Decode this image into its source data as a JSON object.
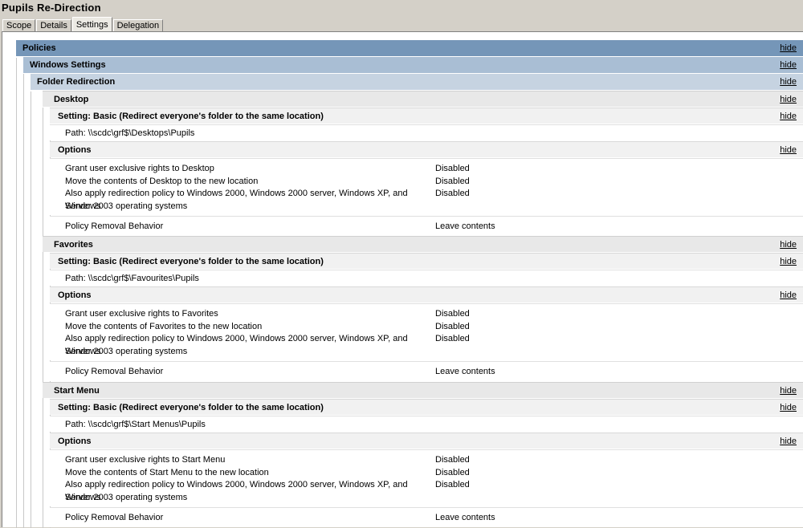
{
  "window": {
    "title": "Pupils Re-Direction"
  },
  "tabs": [
    {
      "label": "Scope"
    },
    {
      "label": "Details"
    },
    {
      "label": "Settings"
    },
    {
      "label": "Delegation"
    }
  ],
  "report": {
    "hide_label": "hide",
    "policies": "Policies",
    "windows_settings": "Windows Settings",
    "folder_redirection": "Folder Redirection",
    "folders": [
      {
        "name": "Desktop",
        "setting": "Setting: Basic (Redirect everyone's folder to the same location)",
        "path": "Path: \\\\scdc\\grf$\\Desktops\\Pupils",
        "options_label": "Options",
        "options": [
          {
            "label": "Grant user exclusive rights to Desktop",
            "value": "Disabled"
          },
          {
            "label": "Move the contents of Desktop to the new location",
            "value": "Disabled"
          },
          {
            "label": "Also apply redirection policy to Windows 2000, Windows 2000 server, Windows XP, and Windows",
            "label2": "Server 2003 operating systems",
            "value": "Disabled"
          }
        ],
        "removal_label": "Policy Removal Behavior",
        "removal_value": "Leave contents"
      },
      {
        "name": "Favorites",
        "setting": "Setting: Basic (Redirect everyone's folder to the same location)",
        "path": "Path: \\\\scdc\\grf$\\Favourites\\Pupils",
        "options_label": "Options",
        "options": [
          {
            "label": "Grant user exclusive rights to Favorites",
            "value": "Disabled"
          },
          {
            "label": "Move the contents of Favorites to the new location",
            "value": "Disabled"
          },
          {
            "label": "Also apply redirection policy to Windows 2000, Windows 2000 server, Windows XP, and Windows",
            "label2": "Server 2003 operating systems",
            "value": "Disabled"
          }
        ],
        "removal_label": "Policy Removal Behavior",
        "removal_value": "Leave contents"
      },
      {
        "name": "Start Menu",
        "setting": "Setting: Basic (Redirect everyone's folder to the same location)",
        "path": "Path: \\\\scdc\\grf$\\Start Menus\\Pupils",
        "options_label": "Options",
        "options": [
          {
            "label": "Grant user exclusive rights to Start Menu",
            "value": "Disabled"
          },
          {
            "label": "Move the contents of Start Menu to the new location",
            "value": "Disabled"
          },
          {
            "label": "Also apply redirection policy to Windows 2000, Windows 2000 server, Windows XP, and Windows",
            "label2": "Server 2003 operating systems",
            "value": "Disabled"
          }
        ],
        "removal_label": "Policy Removal Behavior",
        "removal_value": "Leave contents"
      }
    ]
  }
}
